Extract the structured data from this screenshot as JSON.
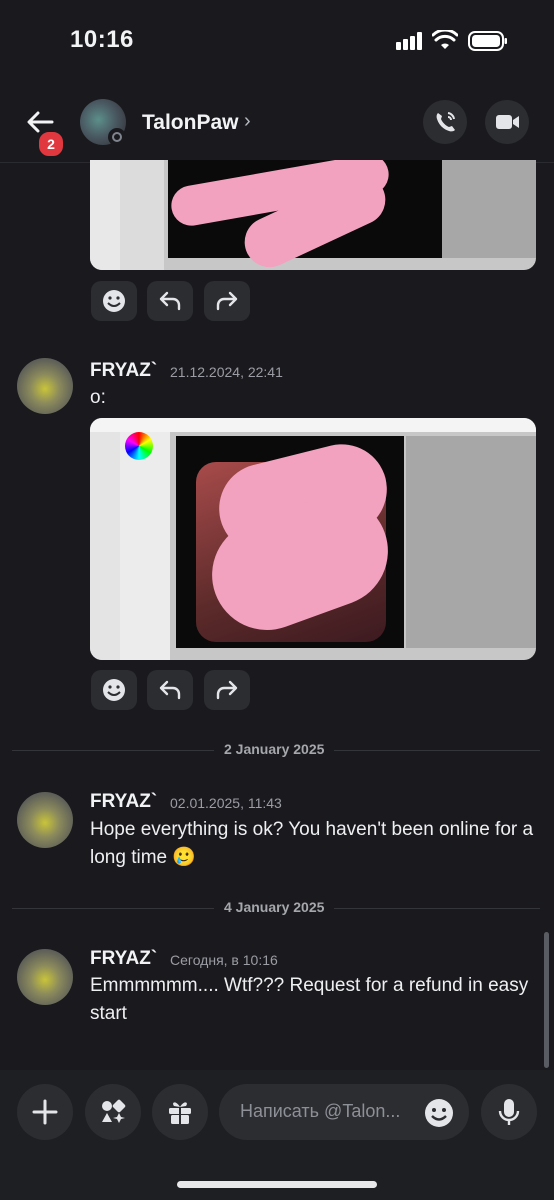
{
  "status_bar": {
    "time": "10:16"
  },
  "header": {
    "unread_badge": "2",
    "contact_name": "TalonPaw",
    "chevron": "›",
    "icons": {
      "back": "arrow-left-icon",
      "call": "phone-icon",
      "video": "video-camera-icon"
    }
  },
  "reactions": {
    "icons": [
      "emoji-icon",
      "reply-icon",
      "forward-icon"
    ]
  },
  "messages": [
    {
      "author": "FRYAZ`",
      "timestamp": "21.12.2024, 22:41",
      "text": "o:"
    },
    {
      "author": "FRYAZ`",
      "timestamp": "02.01.2025, 11:43",
      "text": "Hope everything is ok? You haven't been online for a long time 🥲"
    },
    {
      "author": "FRYAZ`",
      "timestamp": "Сегодня, в 10:16",
      "text": "Emmmmmm.... Wtf???  Request for a refund in easy start"
    }
  ],
  "date_dividers": [
    "2 January 2025",
    "4 January 2025"
  ],
  "composer": {
    "placeholder": "Написать @Talon...",
    "icons": [
      "plus-icon",
      "apps-icon",
      "gift-icon",
      "emoji-icon",
      "microphone-icon"
    ]
  },
  "colors": {
    "background": "#1a1a1e",
    "badge": "#e0383e",
    "censor_pink": "#f2a1bf"
  }
}
